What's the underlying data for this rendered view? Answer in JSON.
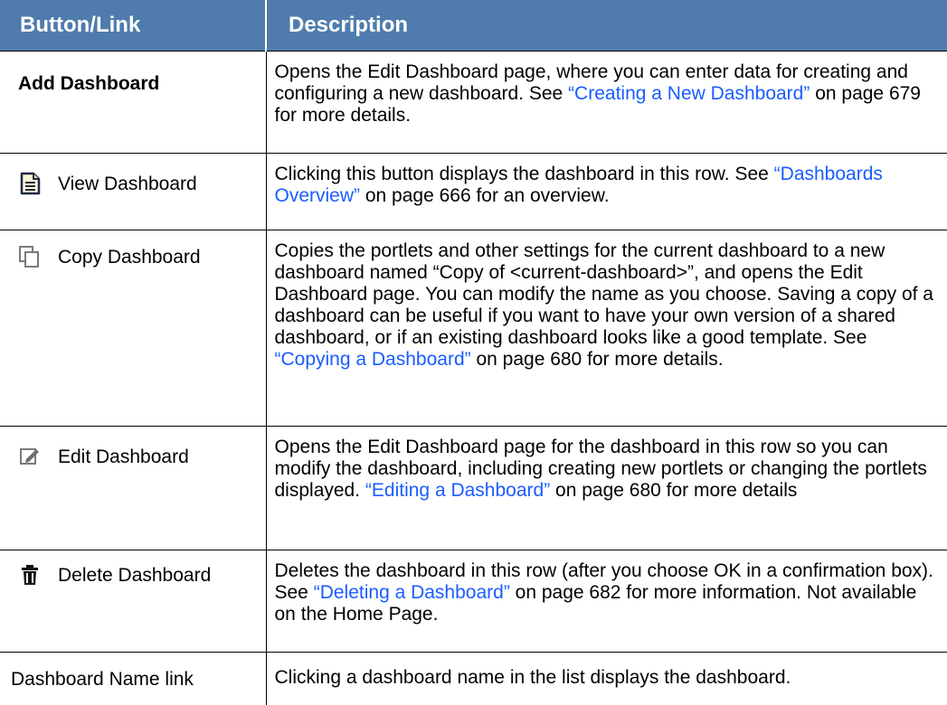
{
  "table": {
    "headers": [
      "Button/Link",
      "Description"
    ],
    "rows": [
      {
        "label": "Add Dashboard",
        "icon": null,
        "desc": {
          "before": "Opens the Edit Dashboard page, where you can enter data for creating and configuring a new dashboard. See ",
          "link": "“Creating a New Dashboard”",
          "after": " on page 679 for more details."
        }
      },
      {
        "label": "View Dashboard",
        "icon": "view-document-icon",
        "desc": {
          "before": "Clicking this button displays the dashboard in this row. See ",
          "link": "“Dashboards Overview”",
          "after": " on page 666 for an overview."
        }
      },
      {
        "label": "Copy Dashboard",
        "icon": "copy-icon",
        "desc": {
          "before": "Copies the portlets and other settings for the current dashboard to a new dashboard named “Copy of <current-dashboard>”, and opens the Edit Dashboard page. You can modify the name as you choose. Saving a copy of a dashboard can be useful if you want to have your own version of a shared dashboard, or if an existing dashboard looks like a good template. See ",
          "link": "“Copying a Dashboard”",
          "after": " on page 680 for more details."
        }
      },
      {
        "label": "Edit Dashboard",
        "icon": "edit-icon",
        "desc": {
          "before": "Opens the Edit Dashboard page for the dashboard in this row so you can modify the dashboard, including creating new portlets or changing the portlets displayed. ",
          "link": "“Editing a Dashboard”",
          "after": " on page 680 for more details"
        }
      },
      {
        "label": "Delete Dashboard",
        "icon": "trash-icon",
        "desc": {
          "before": "Deletes the dashboard in this row (after you choose OK in a confirmation box). See ",
          "link": "“Deleting a Dashboard”",
          "after": " on page 682 for more information. Not available on the Home Page."
        }
      },
      {
        "label": "Dashboard Name link",
        "icon": null,
        "desc": {
          "before": "Clicking a dashboard name in the list displays the dashboard.",
          "link": "",
          "after": ""
        }
      }
    ]
  },
  "colors": {
    "header_bg": "#4f7cad",
    "header_text": "#ffffff",
    "link": "#1a5cff"
  }
}
